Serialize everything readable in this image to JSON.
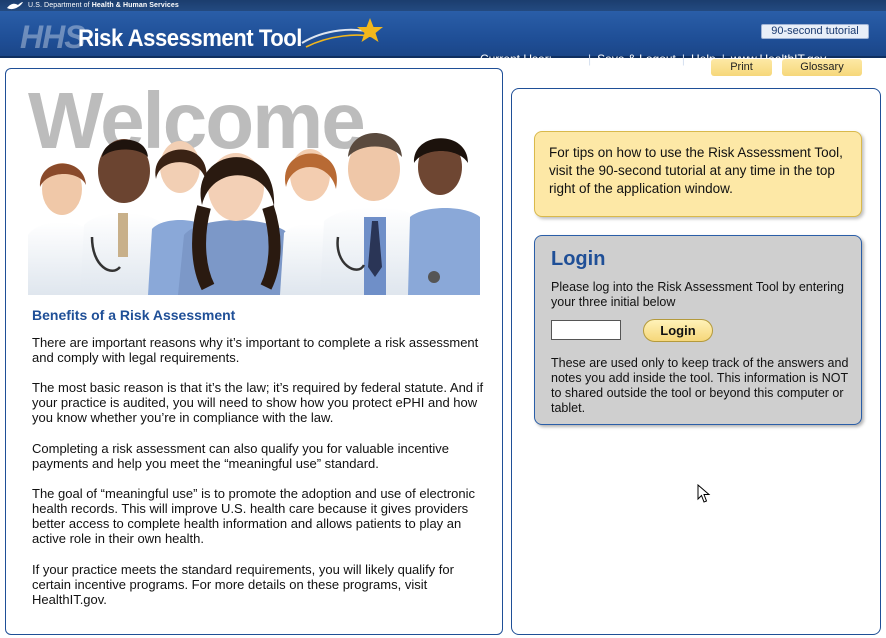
{
  "topbar": {
    "agency_prefix": "U.S. Department of ",
    "agency_bold": "Health & Human Services"
  },
  "header": {
    "logo_text": "HHS",
    "title": "Risk Assessment Tool",
    "tutorial_label": "90-second tutorial",
    "current_user_label": "Current User:",
    "current_user_value": "",
    "nav": {
      "save_logout": "Save & Logout",
      "help": "Help",
      "site": "www.HealthIT.gov"
    },
    "print_label": "Print",
    "glossary_label": "Glossary"
  },
  "left": {
    "welcome": "Welcome",
    "benefits_title": "Benefits of a Risk Assessment",
    "paragraphs": [
      "There are important reasons why it’s important to complete a risk assessment and comply with legal requirements.",
      "The most basic reason is that it’s the law; it’s required by federal statute. And if your practice is audited, you will need to show how you protect ePHI and how you know whether you’re in compliance with the law.",
      "Completing a risk assessment can also qualify you for valuable incentive payments and help you meet the “meaningful use” standard.",
      "The goal of “meaningful use” is to promote the adoption and use of electronic health records. This will improve U.S. health care because it gives providers better access to complete health information and allows patients to play an active role in their own health.",
      "If your practice meets the standard requirements, you will likely qualify for certain incentive programs.  For more details on these programs, visit HealthIT.gov."
    ]
  },
  "right": {
    "tip": "For tips on how to use the Risk Assessment Tool, visit the 90-second tutorial at any time in the top right of the application window.",
    "login": {
      "title": "Login",
      "description": "Please log into the Risk Assessment Tool by entering your three initial below",
      "initials_value": "",
      "button_label": "Login",
      "note": "These are used only to keep track of the answers and notes you add inside the tool. This information is NOT to shared outside the tool or beyond this computer or tablet."
    }
  },
  "colors": {
    "brand_blue": "#1f4f97",
    "tip_yellow": "#fde8a6",
    "login_gray": "#cfcfcf",
    "star_gold": "#f2b71c"
  },
  "icons": {
    "eagle": "hhs-eagle-icon",
    "star": "star-swoosh-icon",
    "cursor": "mouse-pointer-icon"
  }
}
